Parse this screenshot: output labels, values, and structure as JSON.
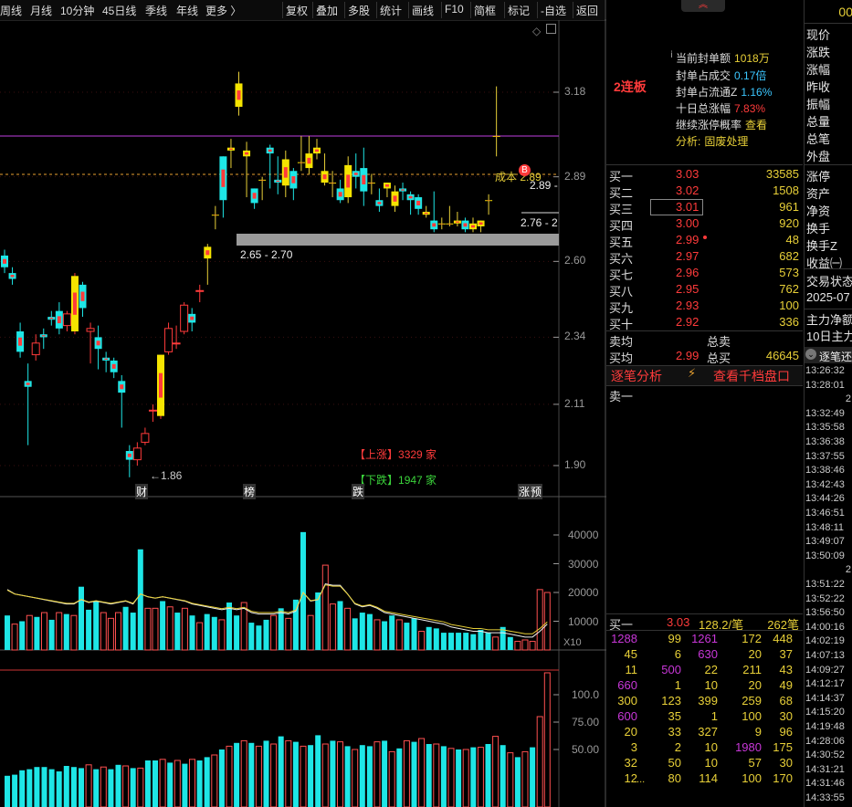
{
  "toolbar": {
    "left_items": [
      "周线",
      "月线",
      "10分钟",
      "45日线",
      "季线",
      "年线",
      "更多 〉"
    ],
    "right_items": [
      "复权",
      "叠加",
      "多股",
      "统计",
      "画线",
      "F10",
      "简框",
      "标记",
      "-自选",
      "返回"
    ]
  },
  "chart": {
    "price_axis": [
      "3.18",
      "2.89",
      "2.60",
      "2.34",
      "2.11",
      "1.90"
    ],
    "vol_axis": [
      "40000",
      "30000",
      "20000",
      "10000"
    ],
    "vol_unit": "X10",
    "ind_axis": [
      "100.0",
      "75.00",
      "50.00"
    ],
    "low_label": "←1.86",
    "range_label": "2.65 - 2.70",
    "cost_label": "成本 2.89",
    "cost_marker": "B",
    "right_price_label_1": "2.89 -",
    "right_price_label_2": "2.76 - 2",
    "up_label": "【上涨】",
    "up_count": "3329 家",
    "down_label": "【下跌】",
    "down_count": "1947 家",
    "markers": [
      "财",
      "榜",
      "跌",
      "涨",
      "预"
    ],
    "candles": [
      [
        2.62,
        2.58,
        2.64,
        2.56
      ],
      [
        2.56,
        2.54,
        2.58,
        2.52
      ],
      [
        2.36,
        2.29,
        2.39,
        2.27
      ],
      [
        2.19,
        2.17,
        2.25,
        1.97
      ],
      [
        2.28,
        2.32,
        2.35,
        2.26
      ],
      [
        2.35,
        2.34,
        2.37,
        2.3
      ],
      [
        2.41,
        2.4,
        2.43,
        2.38
      ],
      [
        2.43,
        2.37,
        2.46,
        2.35
      ],
      [
        2.38,
        2.42,
        2.43,
        2.36
      ],
      [
        2.36,
        2.55,
        2.56,
        2.35
      ],
      [
        2.52,
        2.44,
        2.53,
        2.41
      ],
      [
        2.36,
        2.37,
        2.39,
        2.25
      ],
      [
        2.34,
        2.3,
        2.38,
        2.23
      ],
      [
        2.27,
        2.26,
        2.29,
        2.22
      ],
      [
        2.26,
        2.22,
        2.27,
        2.2
      ],
      [
        2.19,
        2.15,
        2.21,
        2.03
      ],
      [
        1.95,
        1.92,
        1.97,
        1.86
      ],
      [
        1.92,
        1.96,
        1.98,
        1.9
      ],
      [
        1.98,
        2.01,
        2.03,
        1.97
      ],
      [
        2.09,
        2.09,
        2.11,
        2.05
      ],
      [
        2.07,
        2.28,
        2.28,
        2.06
      ],
      [
        2.29,
        2.37,
        2.39,
        2.28
      ],
      [
        2.32,
        2.32,
        2.38,
        2.3
      ],
      [
        2.36,
        2.45,
        2.46,
        2.35
      ],
      [
        2.42,
        2.39,
        2.44,
        2.36
      ],
      [
        2.5,
        2.5,
        2.52,
        2.46
      ],
      [
        2.61,
        2.65,
        2.66,
        2.52
      ],
      [
        2.76,
        2.76,
        2.79,
        2.71
      ],
      [
        2.96,
        2.81,
        2.96,
        2.75
      ],
      [
        2.98,
        2.99,
        3.02,
        2.92
      ],
      [
        3.13,
        3.21,
        3.25,
        3.1
      ],
      [
        2.96,
        2.98,
        3.01,
        2.82
      ],
      [
        2.85,
        2.8,
        2.85,
        2.78
      ],
      [
        2.88,
        2.88,
        2.89,
        2.81
      ],
      [
        2.99,
        2.97,
        3.0,
        2.85
      ],
      [
        2.88,
        2.87,
        2.96,
        2.83
      ],
      [
        2.86,
        2.95,
        2.98,
        2.82
      ],
      [
        2.91,
        2.85,
        2.92,
        2.81
      ],
      [
        2.94,
        2.94,
        3.03,
        2.91
      ],
      [
        2.92,
        2.97,
        3.03,
        2.9
      ],
      [
        2.97,
        2.99,
        3.02,
        2.95
      ],
      [
        2.87,
        2.91,
        2.97,
        2.86
      ],
      [
        2.87,
        2.87,
        2.91,
        2.82
      ],
      [
        2.85,
        2.81,
        2.88,
        2.8
      ],
      [
        2.82,
        2.93,
        2.96,
        2.8
      ],
      [
        2.91,
        2.89,
        2.97,
        2.85
      ],
      [
        2.92,
        2.84,
        2.99,
        2.79
      ],
      [
        2.87,
        2.87,
        2.9,
        2.83
      ],
      [
        2.81,
        2.79,
        2.85,
        2.77
      ],
      [
        2.85,
        2.87,
        2.87,
        2.82
      ],
      [
        2.79,
        2.84,
        2.86,
        2.77
      ],
      [
        2.85,
        2.84,
        2.87,
        2.81
      ],
      [
        2.83,
        2.81,
        2.84,
        2.76
      ],
      [
        2.82,
        2.78,
        2.83,
        2.76
      ],
      [
        2.76,
        2.77,
        2.79,
        2.75
      ],
      [
        2.74,
        2.71,
        2.84,
        2.7
      ],
      [
        2.73,
        2.73,
        2.75,
        2.71
      ],
      [
        2.73,
        2.73,
        2.79,
        2.72
      ],
      [
        2.73,
        2.74,
        2.77,
        2.72
      ],
      [
        2.74,
        2.71,
        2.75,
        2.7
      ],
      [
        2.71,
        2.73,
        2.75,
        2.7
      ],
      [
        2.72,
        2.74,
        2.74,
        2.7
      ],
      [
        2.81,
        2.81,
        2.83,
        2.76
      ],
      [
        3.03,
        3.03,
        3.2,
        2.96
      ]
    ],
    "volumes": [
      12000,
      9000,
      10000,
      12000,
      11500,
      13000,
      10500,
      13000,
      12500,
      12000,
      22000,
      14000,
      17000,
      13000,
      11000,
      13000,
      15000,
      13000,
      35000,
      14500,
      14500,
      17000,
      15000,
      13000,
      14500,
      12000,
      9500,
      12500,
      11500,
      10500,
      16500,
      12000,
      16500,
      9500,
      8500,
      10500,
      12000,
      14500,
      11000,
      17500,
      41000,
      12000,
      20000,
      29500,
      16000,
      17000,
      14500,
      11000,
      13000,
      12500,
      10500,
      10000,
      12000,
      10500,
      9500,
      11000,
      6500,
      8000,
      7500,
      6000,
      6000,
      6000,
      6000,
      5500,
      7000,
      6000,
      4500,
      8000,
      4500,
      3000,
      3500,
      3000,
      21000,
      20000
    ],
    "ma_vol": [
      21000,
      19500,
      19000,
      18500,
      18000,
      17500,
      17000,
      16500,
      16000,
      16000,
      17500,
      16500,
      17000,
      16500,
      16000,
      16500,
      17000,
      16000,
      19500,
      18500,
      18000,
      18500,
      18000,
      17500,
      17000,
      16000,
      15500,
      15000,
      14500,
      14000,
      14500,
      14000,
      14500,
      13000,
      12500,
      12500,
      12500,
      13000,
      12500,
      13500,
      20000,
      17000,
      17500,
      23000,
      22500,
      22500,
      19500,
      16000,
      15000,
      15500,
      14500,
      13000,
      12500,
      12000,
      11500,
      11000,
      10500,
      10000,
      9500,
      9000,
      8000,
      7500,
      7000,
      6500,
      6500,
      6000,
      6000,
      6000,
      5500,
      5000,
      4500,
      4500,
      6500,
      9000
    ],
    "ind": [
      26,
      27,
      31,
      32,
      34,
      34,
      32,
      30,
      35,
      34,
      33,
      36,
      32,
      34,
      32,
      36,
      35,
      33,
      33,
      40,
      40,
      41,
      38,
      40,
      37,
      41,
      40,
      43,
      45,
      50,
      53,
      56,
      58,
      56,
      53,
      58,
      55,
      62,
      58,
      57,
      53,
      54,
      63,
      55,
      58,
      57,
      53,
      50,
      54,
      53,
      57,
      58,
      48,
      51,
      58,
      57,
      60,
      55,
      55,
      53,
      51,
      50,
      50,
      52,
      52,
      55,
      62,
      54,
      47,
      43,
      48,
      52,
      80,
      120
    ]
  },
  "stock": {
    "limit_tag": "2连板",
    "fields": [
      {
        "label": "当前封单额",
        "value": "1018万",
        "color": "#e8d038"
      },
      {
        "label": "封单占成交",
        "value": "0.17倍",
        "color": "#3cc7ff"
      },
      {
        "label": "封单占流通Z",
        "value": "1.16%",
        "color": "#3cc7ff"
      },
      {
        "label": "十日总涨幅",
        "value": "7.83%",
        "color": "#ff3b3b"
      },
      {
        "label": "继续涨停概率",
        "value": "查看",
        "color": "#e8d038"
      },
      {
        "label": "分析:",
        "value": "固废处理",
        "color": "#e8d038"
      }
    ]
  },
  "orderbook": {
    "bids": [
      {
        "label": "买一",
        "price": "3.03",
        "vol": "33585"
      },
      {
        "label": "买二",
        "price": "3.02",
        "vol": "1508"
      },
      {
        "label": "买三",
        "price": "3.01",
        "vol": "961"
      },
      {
        "label": "买四",
        "price": "3.00",
        "vol": "920"
      },
      {
        "label": "买五",
        "price": "2.99",
        "vol": "48"
      },
      {
        "label": "买六",
        "price": "2.97",
        "vol": "682"
      },
      {
        "label": "买七",
        "price": "2.96",
        "vol": "573"
      },
      {
        "label": "买八",
        "price": "2.95",
        "vol": "762"
      },
      {
        "label": "买九",
        "price": "2.93",
        "vol": "100"
      },
      {
        "label": "买十",
        "price": "2.92",
        "vol": "336"
      }
    ],
    "sell_avg_label": "卖均",
    "total_sell_label": "总卖",
    "buy_avg_label": "买均",
    "buy_avg_value": "2.99",
    "total_buy_label": "总买",
    "total_buy_value": "46645",
    "tab_analysis": "逐笔分析",
    "tab_levels": "查看千档盘口",
    "sell1_label": "卖一"
  },
  "bid_detail": {
    "label": "买一",
    "price": "3.03",
    "avg": "128.2/笔",
    "count": "262笔",
    "rows": [
      [
        [
          "1288",
          "#c837d8"
        ],
        [
          "99",
          "#e8d038"
        ],
        [
          "1261",
          "#c837d8"
        ],
        [
          "172",
          "#e8d038"
        ],
        [
          "448",
          "#e8d038"
        ]
      ],
      [
        [
          "45",
          "#e8d038"
        ],
        [
          "6",
          "#e8d038"
        ],
        [
          "630",
          "#c837d8"
        ],
        [
          "20",
          "#e8d038"
        ],
        [
          "37",
          "#e8d038"
        ]
      ],
      [
        [
          "11",
          "#e8d038"
        ],
        [
          "500",
          "#c837d8"
        ],
        [
          "22",
          "#e8d038"
        ],
        [
          "211",
          "#e8d038"
        ],
        [
          "43",
          "#e8d038"
        ]
      ],
      [
        [
          "660",
          "#c837d8"
        ],
        [
          "1",
          "#e8d038"
        ],
        [
          "10",
          "#e8d038"
        ],
        [
          "20",
          "#e8d038"
        ],
        [
          "49",
          "#e8d038"
        ]
      ],
      [
        [
          "300",
          "#e8d038"
        ],
        [
          "123",
          "#e8d038"
        ],
        [
          "399",
          "#e8d038"
        ],
        [
          "259",
          "#e8d038"
        ],
        [
          "68",
          "#e8d038"
        ]
      ],
      [
        [
          "600",
          "#c837d8"
        ],
        [
          "35",
          "#e8d038"
        ],
        [
          "1",
          "#e8d038"
        ],
        [
          "100",
          "#e8d038"
        ],
        [
          "30",
          "#e8d038"
        ]
      ],
      [
        [
          "20",
          "#e8d038"
        ],
        [
          "33",
          "#e8d038"
        ],
        [
          "327",
          "#e8d038"
        ],
        [
          "9",
          "#e8d038"
        ],
        [
          "96",
          "#e8d038"
        ]
      ],
      [
        [
          "3",
          "#e8d038"
        ],
        [
          "2",
          "#e8d038"
        ],
        [
          "10",
          "#e8d038"
        ],
        [
          "1980",
          "#c837d8"
        ],
        [
          "175",
          "#e8d038"
        ]
      ],
      [
        [
          "32",
          "#e8d038"
        ],
        [
          "50",
          "#e8d038"
        ],
        [
          "10",
          "#e8d038"
        ],
        [
          "57",
          "#e8d038"
        ],
        [
          "30",
          "#e8d038"
        ]
      ],
      [
        [
          "12",
          "#e8d038"
        ],
        [
          "80",
          "#e8d038"
        ],
        [
          "114",
          "#e8d038"
        ],
        [
          "100",
          "#e8d038"
        ],
        [
          "170",
          "#e8d038"
        ]
      ]
    ],
    "more": "...."
  },
  "right_panel": {
    "top_code": "00",
    "labels": [
      "现价",
      "涨跌",
      "涨幅",
      "昨收",
      "振幅",
      "总量",
      "总笔",
      "外盘",
      "",
      "涨停",
      "资产",
      "净资",
      "换手",
      "换手Z",
      "收益㈠",
      "交易状态",
      "2025-07",
      "主力净额",
      "10日主力"
    ],
    "trade_tab": "逐笔还",
    "ticks": [
      [
        "13:26:32",
        ""
      ],
      [
        "13:28:01",
        ""
      ],
      [
        "",
        "2"
      ],
      [
        "13:32:49",
        ""
      ],
      [
        "13:35:58",
        ""
      ],
      [
        "13:36:38",
        ""
      ],
      [
        "13:37:55",
        ""
      ],
      [
        "13:38:46",
        ""
      ],
      [
        "13:42:43",
        ""
      ],
      [
        "13:44:26",
        ""
      ],
      [
        "13:46:51",
        ""
      ],
      [
        "13:48:11",
        ""
      ],
      [
        "13:49:07",
        ""
      ],
      [
        "13:50:09",
        ""
      ],
      [
        "",
        "2"
      ],
      [
        "13:51:22",
        ""
      ],
      [
        "13:52:22",
        ""
      ],
      [
        "13:56:50",
        ""
      ],
      [
        "14:00:16",
        ""
      ],
      [
        "14:02:19",
        ""
      ],
      [
        "14:07:13",
        ""
      ],
      [
        "14:09:27",
        ""
      ],
      [
        "14:12:17",
        ""
      ],
      [
        "14:14:37",
        ""
      ],
      [
        "14:15:20",
        ""
      ],
      [
        "14:19:48",
        ""
      ],
      [
        "14:28:06",
        ""
      ],
      [
        "14:30:52",
        ""
      ],
      [
        "14:31:21",
        ""
      ],
      [
        "14:31:46",
        ""
      ],
      [
        "14:33:55",
        ""
      ]
    ]
  }
}
